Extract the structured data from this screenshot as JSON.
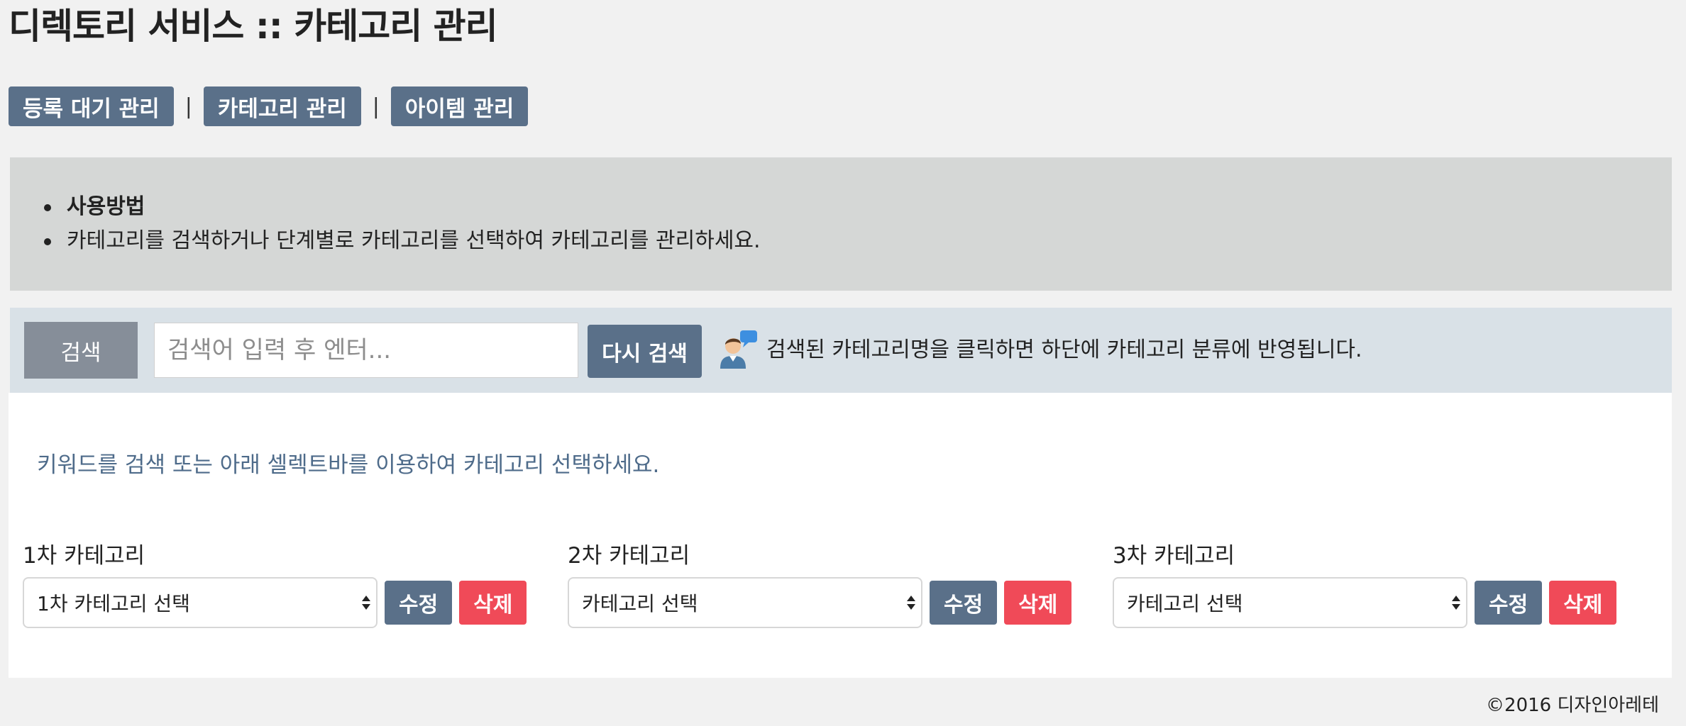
{
  "page_title": "디렉토리 서비스 :: 카테고리 관리",
  "nav": {
    "items": [
      "등록 대기 관리",
      "카테고리 관리",
      "아이템 관리"
    ],
    "separator": "|"
  },
  "help": {
    "items": [
      "사용방법",
      "카테고리를 검색하거나 단계별로 카테고리를 선택하여 카테고리를 관리하세요."
    ]
  },
  "search": {
    "label": "검색",
    "placeholder": "검색어 입력 후 엔터...",
    "value": "",
    "research_label": "다시 검색",
    "hint_icon": "person-speech-icon",
    "hint": "검색된 카테고리명을 클릭하면 하단에 카테고리 분류에 반영됩니다."
  },
  "main": {
    "guide": "키워드를 검색 또는 아래 셀렉트바를 이용하여 카테고리 선택하세요.",
    "categories": [
      {
        "label": "1차 카테고리",
        "selected": "1차 카테고리 선택",
        "edit": "수정",
        "delete": "삭제"
      },
      {
        "label": "2차 카테고리",
        "selected": "카테고리 선택",
        "edit": "수정",
        "delete": "삭제"
      },
      {
        "label": "3차 카테고리",
        "selected": "카테고리 선택",
        "edit": "수정",
        "delete": "삭제"
      }
    ]
  },
  "footer": "©2016 디자인아레테",
  "colors": {
    "primary": "#5a7089",
    "danger": "#f04a58",
    "help_bg": "#d5d7d6",
    "search_bg": "#d9e1e7",
    "guide_text": "#4e6b8a"
  }
}
